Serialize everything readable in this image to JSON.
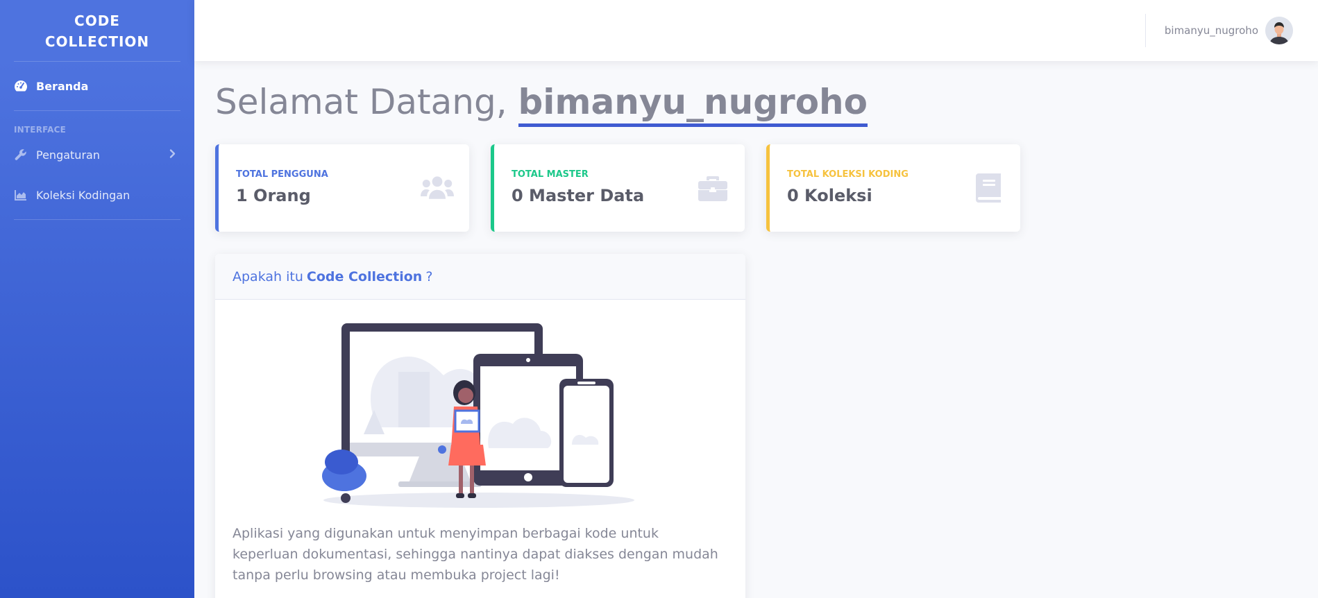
{
  "brand": {
    "line1": "CODE",
    "line2": "COLLECTION"
  },
  "sidebar": {
    "items": [
      {
        "label": "Beranda",
        "icon": "tachometer-icon",
        "active": true
      },
      {
        "label": "Pengaturan",
        "icon": "wrench-icon",
        "has_submenu": true
      },
      {
        "label": "Koleksi Kodingan",
        "icon": "chart-area-icon"
      }
    ],
    "heading": "INTERFACE"
  },
  "topbar": {
    "username": "bimanyu_nugroho"
  },
  "welcome": {
    "prefix": "Selamat Datang,",
    "name": "bimanyu_nugroho"
  },
  "cards": [
    {
      "label": "TOTAL PENGGUNA",
      "value": "1 Orang",
      "icon": "users-icon",
      "color": "#4e73df"
    },
    {
      "label": "TOTAL MASTER",
      "value": "0 Master Data",
      "icon": "briefcase-icon",
      "color": "#1cc88a"
    },
    {
      "label": "TOTAL KOLEKSI KODING",
      "value": "0 Koleksi",
      "icon": "book-icon",
      "color": "#f6c23e"
    }
  ],
  "info": {
    "title_prefix": "Apakah itu",
    "title_bold": "Code Collection",
    "title_suffix": "?",
    "description": "Aplikasi yang digunakan untuk menyimpan berbagai kode untuk keperluan dokumentasi, sehingga nantinya dapat diakses dengan mudah tanpa perlu browsing atau membuka project lagi!"
  }
}
